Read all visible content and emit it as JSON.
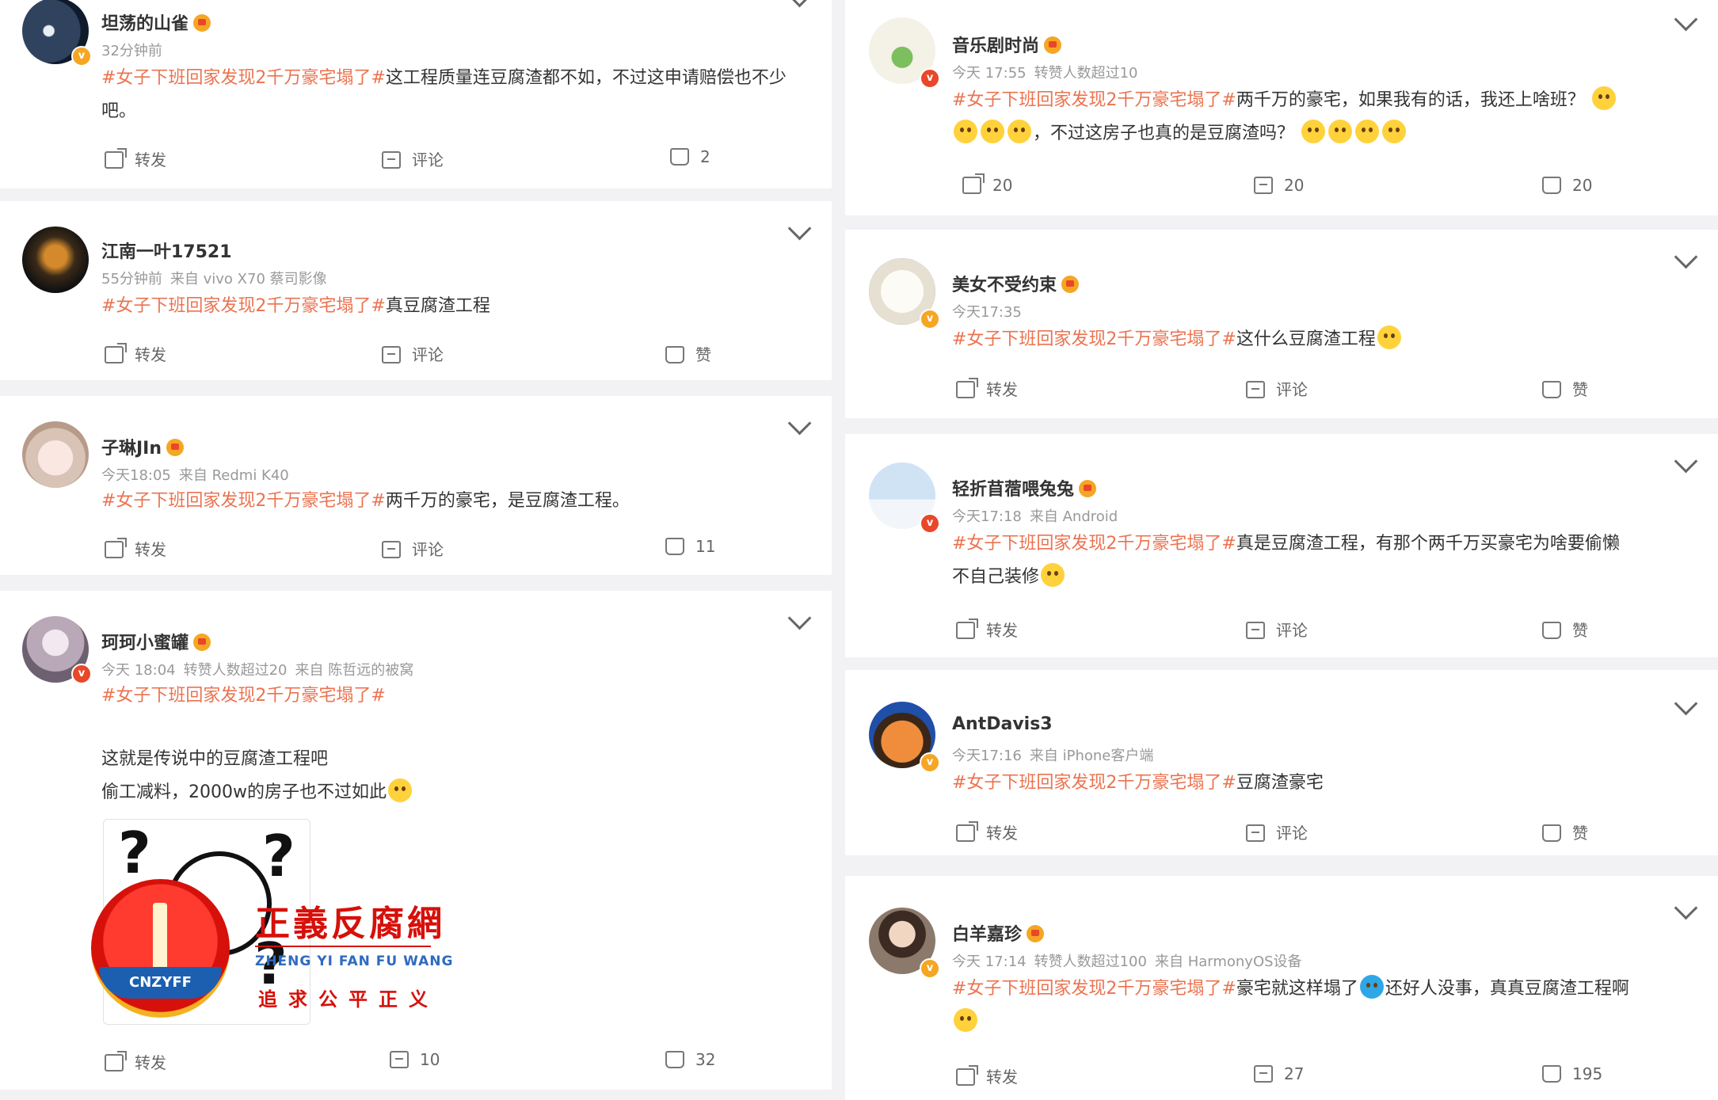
{
  "labels": {
    "repost": "转发",
    "comment": "评论",
    "like": "赞"
  },
  "left": [
    {
      "name": "坦荡的山雀",
      "meta": [
        "32分钟前"
      ],
      "hashtag": "#女子下班回家发现2千万豪宅塌了#",
      "text": "这工程质量连豆腐渣都不如，不过这申请赔偿也不少吧。",
      "repost": "转发",
      "comment": "评论",
      "like": "2"
    },
    {
      "name": "江南一叶17521",
      "meta": [
        "55分钟前",
        "来自 vivo X70 蔡司影像"
      ],
      "hashtag": "#女子下班回家发现2千万豪宅塌了#",
      "text": "真豆腐渣工程",
      "repost": "转发",
      "comment": "评论",
      "like": "赞"
    },
    {
      "name": "子琳JIn",
      "meta": [
        "今天18:05",
        "来自 Redmi K40"
      ],
      "hashtag": "#女子下班回家发现2千万豪宅塌了#",
      "text": "两千万的豪宅，是豆腐渣工程。",
      "repost": "转发",
      "comment": "评论",
      "like": "11"
    },
    {
      "name": "珂珂小蜜罐",
      "meta": [
        "今天 18:04",
        "转赞人数超过20",
        "来自 陈哲远的被窝"
      ],
      "hashtag": "#女子下班回家发现2千万豪宅塌了#",
      "line1": "这就是传说中的豆腐渣工程吧",
      "line2": "偷工减料，2000w的房子也不过如此",
      "repost": "转发",
      "comment": "10",
      "like": "32"
    }
  ],
  "right": [
    {
      "name": "音乐剧时尚",
      "meta": [
        "今天 17:55",
        "转赞人数超过10"
      ],
      "hashtag": "#女子下班回家发现2千万豪宅塌了#",
      "text": "两千万的豪宅，如果我有的话，我还上啥班？",
      "text2": "，不过这房子也真的是豆腐渣吗？",
      "repost": "20",
      "comment": "20",
      "like": "20"
    },
    {
      "name": "美女不受约束",
      "meta": [
        "今天17:35"
      ],
      "hashtag": "#女子下班回家发现2千万豪宅塌了#",
      "text": "这什么豆腐渣工程",
      "repost": "转发",
      "comment": "评论",
      "like": "赞"
    },
    {
      "name": "轻折苜蓿喂兔兔",
      "meta": [
        "今天17:18",
        "来自 Android"
      ],
      "hashtag": "#女子下班回家发现2千万豪宅塌了#",
      "text": "真是豆腐渣工程，有那个两千万买豪宅为啥要偷懒",
      "text2": "不自己装修",
      "repost": "转发",
      "comment": "评论",
      "like": "赞"
    },
    {
      "name": "AntDavis3",
      "meta": [
        "今天17:16",
        "来自 iPhone客户端"
      ],
      "hashtag": "#女子下班回家发现2千万豪宅塌了#",
      "text": "豆腐渣豪宅",
      "repost": "转发",
      "comment": "评论",
      "like": "赞"
    },
    {
      "name": "白羊嘉珍",
      "meta": [
        "今天 17:14",
        "转赞人数超过100",
        "来自 HarmonyOS设备"
      ],
      "hashtag": "#女子下班回家发现2千万豪宅塌了#",
      "text": "豪宅就这样塌了",
      "text_b": "还好人没事，真真豆腐渣工程啊",
      "repost": "转发",
      "comment": "27",
      "like": "195"
    }
  ],
  "watermark": {
    "title": "正義反腐網",
    "english": "ZHENG YI FAN FU WANG",
    "slogan": "追求公平正义",
    "logo_text": "CNZYFF"
  },
  "colors": {
    "hashtag": "#eb7350",
    "meta": "#999999",
    "badge": "#f5a623"
  }
}
